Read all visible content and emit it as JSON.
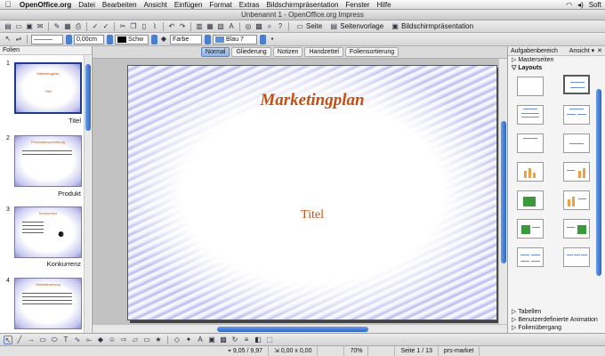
{
  "menubar": {
    "app": "OpenOffice.org",
    "items": [
      "Datei",
      "Bearbeiten",
      "Ansicht",
      "Einfügen",
      "Format",
      "Extras",
      "Bildschirmpräsentation",
      "Fenster",
      "Hilfe"
    ],
    "right": "Soft"
  },
  "window": {
    "title": "Unbenannt 1 - OpenOffice.org Impress"
  },
  "toolbar1": {
    "seite": "Seite",
    "seitenvorlage": "Seitenvorlage",
    "praesentation": "Bildschirmpräsentation"
  },
  "toolbar2": {
    "line_width": "0,00cm",
    "line_color": "Schw",
    "area_style": "Farbe",
    "area_color": "Blau 7",
    "line_color_hex": "#000000",
    "area_color_hex": "#5b8fd8"
  },
  "slides_pane": {
    "header": "Folien",
    "slides": [
      {
        "num": "1",
        "name": "Titel",
        "thumb_title": "Marketingplan",
        "thumb_sub": "Titel"
      },
      {
        "num": "2",
        "name": "Produkt",
        "thumb_title": "Produktbeschreibung"
      },
      {
        "num": "3",
        "name": "Konkurrenz",
        "thumb_title": "Konkurrenz"
      },
      {
        "num": "4",
        "name": "",
        "thumb_title": "Marktsituierung"
      }
    ]
  },
  "view_tabs": [
    "Normal",
    "Gliederung",
    "Notizen",
    "Handzettel",
    "Foliensortierung"
  ],
  "slide": {
    "title": "Marketingplan",
    "subtitle": "Titel",
    "text_color": "#c84e10"
  },
  "task_pane": {
    "title": "Aufgabenbereich",
    "view": "Ansicht",
    "sections": [
      "Masterseiten",
      "Layouts"
    ],
    "bottom_sections": [
      "Tabellen",
      "Benutzerdefinierte Animation",
      "Folienübergang"
    ]
  },
  "status": {
    "position": "9,05 / 9,97",
    "size": "0,00 x 0,00",
    "zoom": "70%",
    "page": "Seite 1 / 13",
    "master": "prs-market"
  }
}
